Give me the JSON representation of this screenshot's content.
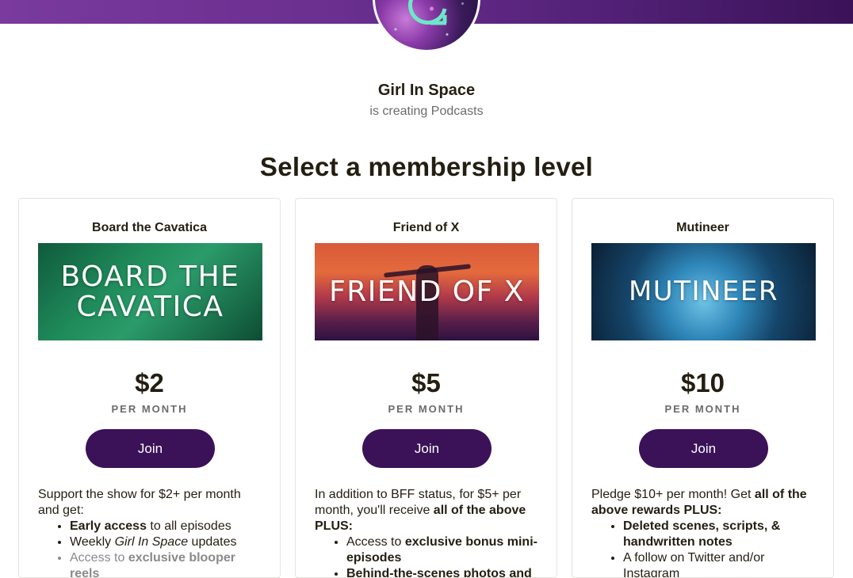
{
  "creator": {
    "name": "Girl In Space",
    "subtitle": "is creating Podcasts",
    "avatar_letter": "G"
  },
  "section_title": "Select a membership level",
  "tiers": [
    {
      "name": "Board the Cavatica",
      "image_text": [
        "BOARD THE",
        "CAVATICA"
      ],
      "price": "$2",
      "per": "PER MONTH",
      "join_label": "Join",
      "intro": "Support the show for $2+ per month and get:",
      "benefits": [
        {
          "bold": "Early access",
          "rest": " to all episodes"
        },
        {
          "pre": "Weekly ",
          "italic": "Girl In Space",
          "rest": " updates"
        },
        {
          "pre": "Access to ",
          "bold": "exclusive blooper reels"
        }
      ]
    },
    {
      "name": "Friend of X",
      "image_text": [
        "FRIEND OF X"
      ],
      "price": "$5",
      "per": "PER MONTH",
      "join_label": "Join",
      "intro_plain": "In addition to BFF status, for $5+ per month, you'll receive ",
      "intro_bold": "all of the above PLUS:",
      "benefits": [
        {
          "pre": "Access to ",
          "bold": "exclusive bonus mini-episodes"
        },
        {
          "bold": "Behind-the-scenes photos and"
        }
      ]
    },
    {
      "name": "Mutineer",
      "image_text": [
        "MUTINEER"
      ],
      "price": "$10",
      "per": "PER MONTH",
      "join_label": "Join",
      "intro_plain": "Pledge $10+ per month! Get ",
      "intro_bold": "all of the above rewards PLUS:",
      "benefits": [
        {
          "bold": "Deleted scenes, scripts, & handwritten notes"
        },
        {
          "pre": "A follow on Twitter and/or Instagram"
        }
      ]
    }
  ],
  "colors": {
    "banner": "#6a2f8f",
    "button": "#3b1258",
    "text": "#241e12",
    "muted": "#6b6b6b"
  }
}
